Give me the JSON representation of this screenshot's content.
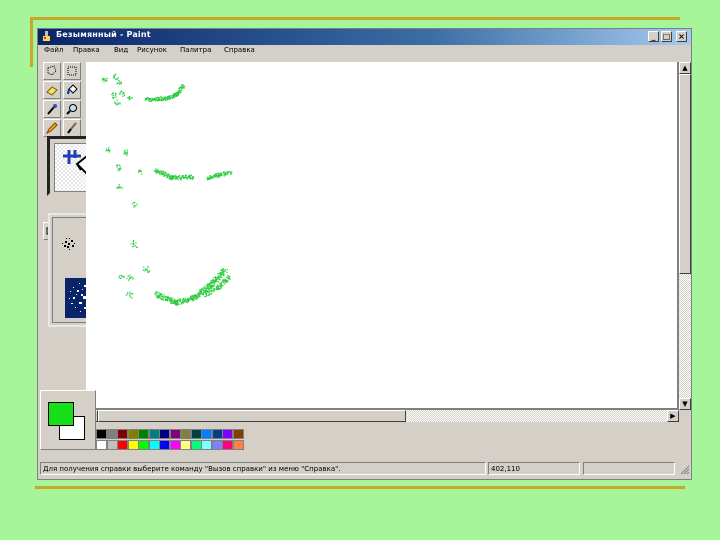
{
  "window": {
    "title": "Безымянный - Paint",
    "buttons": [
      "_",
      "□",
      "×"
    ]
  },
  "menu": [
    "Файл",
    "Правка",
    "Вид",
    "Рисунок",
    "Палитра",
    "Справка"
  ],
  "tools": [
    "free-select",
    "rect-select",
    "eraser",
    "fill",
    "color-picker",
    "magnifier",
    "pencil",
    "brush",
    "airbrush",
    "text",
    "line",
    "curve",
    "rectangle",
    "polygon",
    "ellipse",
    "rounded-rectangle"
  ],
  "airbrush_sizes": [
    "small",
    "medium",
    "large"
  ],
  "colors": {
    "foreground": "#18e018",
    "background": "#ffffff",
    "spray": "#2ecc40",
    "palette_row1": [
      "#000000",
      "#808080",
      "#800000",
      "#808000",
      "#008000",
      "#008080",
      "#000080",
      "#800080",
      "#808040",
      "#004040",
      "#0080ff",
      "#004080",
      "#8000ff",
      "#804000"
    ],
    "palette_row2": [
      "#ffffff",
      "#c0c0c0",
      "#ff0000",
      "#ffff00",
      "#00ff00",
      "#00ffff",
      "#0000ff",
      "#ff00ff",
      "#ffff80",
      "#00ff80",
      "#80ffff",
      "#8080ff",
      "#ff0080",
      "#ff8040"
    ]
  },
  "status": {
    "help_text": "Для получения справки выберите команду \"Вызов справки\" из меню \"Справка\".",
    "coords": "402,110"
  }
}
